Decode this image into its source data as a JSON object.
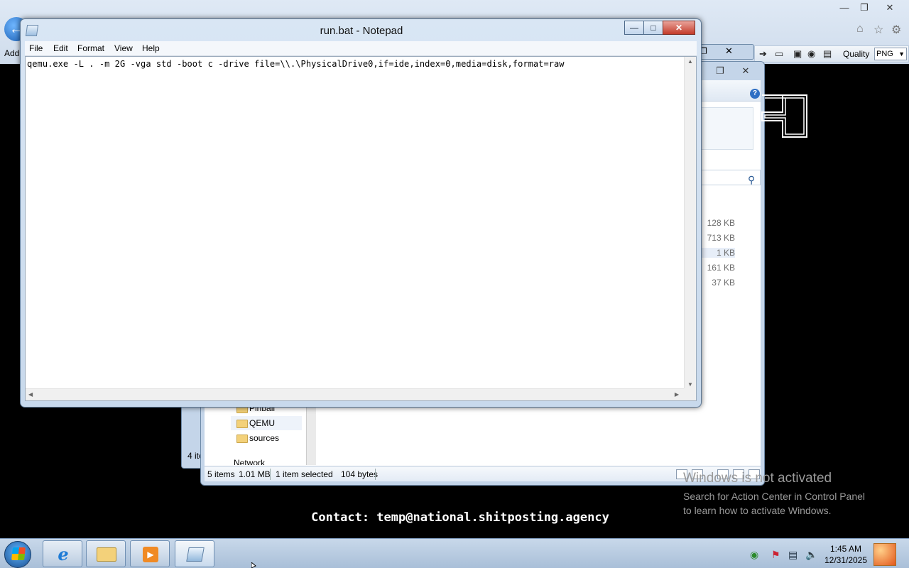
{
  "browser": {
    "address_label": "Add",
    "toolbar": {
      "quality_label": "Quality",
      "quality_value": "PNG"
    },
    "icons": [
      "back-icon",
      "home-icon",
      "favorites-star-icon",
      "settings-gear-icon",
      "forward-icon",
      "bookmark-icon",
      "save-icon",
      "binoculars-icon",
      "clipboard-icon"
    ]
  },
  "explorer": {
    "file_sizes": [
      "128 KB",
      "713 KB",
      "1 KB",
      "161 KB",
      "37 KB"
    ],
    "nav_items": [
      {
        "label": "Pinball"
      },
      {
        "label": "QEMU"
      },
      {
        "label": "sources"
      },
      {
        "label": "Network"
      }
    ],
    "status": {
      "items": "5 items",
      "size": "1.01 MB",
      "selected": "1 item selected",
      "bytes": "104 bytes"
    },
    "left_window_status": "4 ite"
  },
  "notepad": {
    "title": "run.bat - Notepad",
    "menu": [
      "File",
      "Edit",
      "Format",
      "View",
      "Help"
    ],
    "content": "qemu.exe -L . -m 2G -vga std -boot c -drive file=\\\\.\\PhysicalDrive0,if=ide,index=0,media=disk,format=raw"
  },
  "overlay": {
    "contact": "Contact: temp@national.shitposting.agency",
    "activation_title": "Windows is not activated",
    "activation_line1": "Search for Action Center in Control Panel",
    "activation_line2": "to learn how to activate Windows."
  },
  "taskbar": {
    "apps": [
      {
        "name": "internet-explorer",
        "icon": "ie-icon"
      },
      {
        "name": "windows-explorer",
        "icon": "folder-icon"
      },
      {
        "name": "media-player",
        "icon": "play-icon"
      },
      {
        "name": "notepad",
        "icon": "notepad-icon",
        "active": true
      }
    ],
    "clock_time": "1:45 AM",
    "clock_date": "12/31/2025"
  }
}
